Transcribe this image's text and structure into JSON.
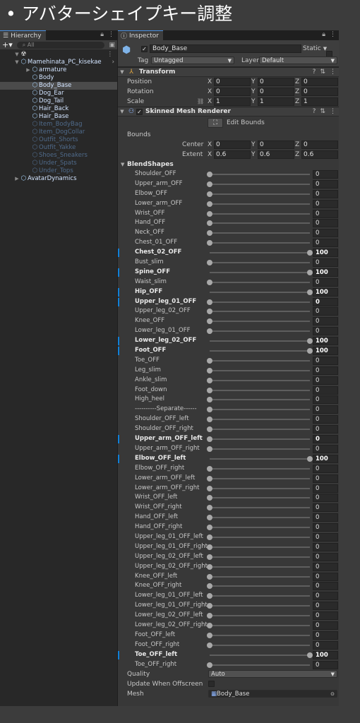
{
  "slide": {
    "bullet": "•",
    "title": "アバターシェイプキー調整"
  },
  "hierarchy": {
    "tab_label": "Hierarchy",
    "search_placeholder": "All",
    "root_label": "",
    "items": [
      {
        "label": "Mamehinata_PC_kisekae",
        "depth": 1,
        "state": "active",
        "expand": "open"
      },
      {
        "label": "armature",
        "depth": 2,
        "state": "active",
        "expand": "closed"
      },
      {
        "label": "Body",
        "depth": 2,
        "state": "active",
        "expand": ""
      },
      {
        "label": "Body_Base",
        "depth": 2,
        "state": "selected",
        "expand": ""
      },
      {
        "label": "Dog_Ear",
        "depth": 2,
        "state": "active",
        "expand": ""
      },
      {
        "label": "Dog_Tail",
        "depth": 2,
        "state": "active",
        "expand": ""
      },
      {
        "label": "Hair_Back",
        "depth": 2,
        "state": "active",
        "expand": ""
      },
      {
        "label": "Hair_Base",
        "depth": 2,
        "state": "active",
        "expand": ""
      },
      {
        "label": "Item_BodyBag",
        "depth": 2,
        "state": "dim",
        "expand": ""
      },
      {
        "label": "Item_DogCollar",
        "depth": 2,
        "state": "dim",
        "expand": ""
      },
      {
        "label": "Outfit_Shorts",
        "depth": 2,
        "state": "dim",
        "expand": ""
      },
      {
        "label": "Outfit_Yakke",
        "depth": 2,
        "state": "dim",
        "expand": ""
      },
      {
        "label": "Shoes_Sneakers",
        "depth": 2,
        "state": "dim",
        "expand": ""
      },
      {
        "label": "Under_Spats",
        "depth": 2,
        "state": "dim",
        "expand": ""
      },
      {
        "label": "Under_Tops",
        "depth": 2,
        "state": "dim",
        "expand": ""
      },
      {
        "label": "AvatarDynamics",
        "depth": 1,
        "state": "active",
        "expand": "closed"
      }
    ]
  },
  "inspector": {
    "tab_label": "Inspector",
    "object_name": "Body_Base",
    "static_label": "Static",
    "tag_label": "Tag",
    "tag_value": "Untagged",
    "layer_label": "Layer",
    "layer_value": "Default",
    "transform": {
      "title": "Transform",
      "rows": [
        {
          "label": "Position",
          "x": "0",
          "y": "0",
          "z": "0"
        },
        {
          "label": "Rotation",
          "x": "0",
          "y": "0",
          "z": "0"
        },
        {
          "label": "Scale",
          "x": "1",
          "y": "1",
          "z": "1"
        }
      ]
    },
    "renderer": {
      "title": "Skinned Mesh Renderer",
      "edit_bounds_label": "Edit Bounds",
      "bounds_label": "Bounds",
      "center": {
        "label": "Center",
        "x": "0",
        "y": "0",
        "z": "0"
      },
      "extent": {
        "label": "Extent",
        "x": "0.6",
        "y": "0.6",
        "z": "0.6"
      },
      "blendshapes_label": "BlendShapes",
      "blendshapes": [
        {
          "name": "Shoulder_OFF",
          "value": 0
        },
        {
          "name": "Upper_arm_OFF",
          "value": 0
        },
        {
          "name": "Elbow_OFF",
          "value": 0
        },
        {
          "name": "Lower_arm_OFF",
          "value": 0
        },
        {
          "name": "Wrist_OFF",
          "value": 0
        },
        {
          "name": "Hand_OFF",
          "value": 0
        },
        {
          "name": "Neck_OFF",
          "value": 0
        },
        {
          "name": "Chest_01_OFF",
          "value": 0
        },
        {
          "name": "Chest_02_OFF",
          "value": 100,
          "modified": true
        },
        {
          "name": "Bust_slim",
          "value": 0
        },
        {
          "name": "Spine_OFF",
          "value": 100,
          "modified": true
        },
        {
          "name": "Waist_slim",
          "value": 0
        },
        {
          "name": "Hip_OFF",
          "value": 100,
          "modified": true
        },
        {
          "name": "Upper_leg_01_OFF",
          "value": 0,
          "modified": true
        },
        {
          "name": "Upper_leg_02_OFF",
          "value": 0
        },
        {
          "name": "Knee_OFF",
          "value": 0
        },
        {
          "name": "Lower_leg_01_OFF",
          "value": 0
        },
        {
          "name": "Lower_leg_02_OFF",
          "value": 100,
          "modified": true
        },
        {
          "name": "Foot_OFF",
          "value": 100,
          "modified": true
        },
        {
          "name": "Toe_OFF",
          "value": 0
        },
        {
          "name": "Leg_slim",
          "value": 0
        },
        {
          "name": "Ankle_slim",
          "value": 0
        },
        {
          "name": "Foot_down",
          "value": 0
        },
        {
          "name": "High_heel",
          "value": 0
        },
        {
          "name": "----------Separate------",
          "value": 0
        },
        {
          "name": "Shoulder_OFF_left",
          "value": 0
        },
        {
          "name": "Shoulder_OFF_right",
          "value": 0
        },
        {
          "name": "Upper_arm_OFF_left",
          "value": 0,
          "modified": true
        },
        {
          "name": "Upper_arm_OFF_right",
          "value": 0
        },
        {
          "name": "Elbow_OFF_left",
          "value": 100,
          "modified": true
        },
        {
          "name": "Elbow_OFF_right",
          "value": 0
        },
        {
          "name": "Lower_arm_OFF_left",
          "value": 0
        },
        {
          "name": "Lower_arm_OFF_right",
          "value": 0
        },
        {
          "name": "Wrist_OFF_left",
          "value": 0
        },
        {
          "name": "Wrist_OFF_right",
          "value": 0
        },
        {
          "name": "Hand_OFF_left",
          "value": 0
        },
        {
          "name": "Hand_OFF_right",
          "value": 0
        },
        {
          "name": "Upper_leg_01_OFF_left",
          "value": 0
        },
        {
          "name": "Upper_leg_01_OFF_right",
          "value": 0
        },
        {
          "name": "Upper_leg_02_OFF_left",
          "value": 0
        },
        {
          "name": "Upper_leg_02_OFF_right",
          "value": 0
        },
        {
          "name": "Knee_OFF_left",
          "value": 0
        },
        {
          "name": "Knee_OFF_right",
          "value": 0
        },
        {
          "name": "Lower_leg_01_OFF_left",
          "value": 0
        },
        {
          "name": "Lower_leg_01_OFF_right",
          "value": 0
        },
        {
          "name": "Lower_leg_02_OFF_left",
          "value": 0
        },
        {
          "name": "Lower_leg_02_OFF_right",
          "value": 0
        },
        {
          "name": "Foot_OFF_left",
          "value": 0
        },
        {
          "name": "Foot_OFF_right",
          "value": 0
        },
        {
          "name": "Toe_OFF_left",
          "value": 100,
          "modified": true
        },
        {
          "name": "Toe_OFF_right",
          "value": 0
        }
      ],
      "quality_label": "Quality",
      "quality_value": "Auto",
      "update_offscreen_label": "Update When Offscreen",
      "mesh_label": "Mesh",
      "mesh_value": "Body_Base"
    }
  }
}
